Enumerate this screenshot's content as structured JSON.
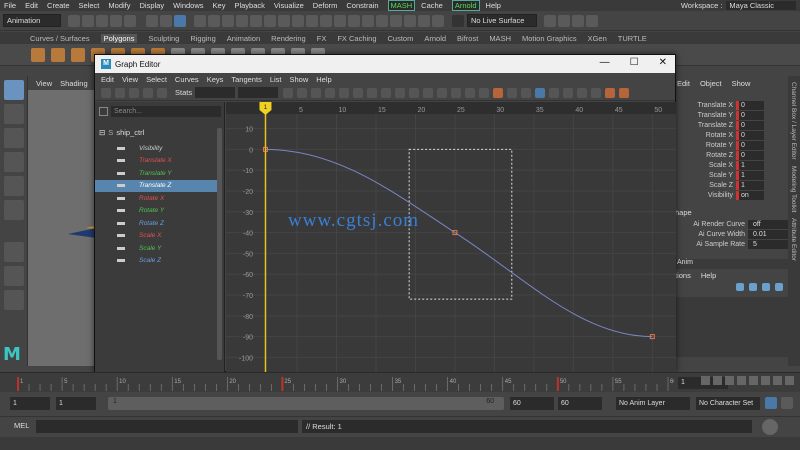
{
  "menubar": {
    "items": [
      "File",
      "Edit",
      "Create",
      "Select",
      "Modify",
      "Display",
      "Windows",
      "Key",
      "Playback",
      "Visualize",
      "Deform",
      "Constrain",
      "MASH",
      "Cache",
      "Arnold",
      "Help"
    ],
    "workspace_label": "Workspace :",
    "workspace_value": "Maya Classic"
  },
  "statusline": {
    "mode": "Animation",
    "live_surface": "No Live Surface"
  },
  "shelf": {
    "tabs": [
      "Curves / Surfaces",
      "Polygons",
      "Sculpting",
      "Rigging",
      "Animation",
      "Rendering",
      "FX",
      "FX Caching",
      "Custom",
      "Arnold",
      "Bifrost",
      "MASH",
      "Motion Graphics",
      "XGen",
      "TURTLE"
    ],
    "active_tab": "Polygons"
  },
  "viewport": {
    "menu": [
      "View",
      "Shading"
    ]
  },
  "graph_editor": {
    "title": "Graph Editor",
    "menu": [
      "Edit",
      "View",
      "Select",
      "Curves",
      "Keys",
      "Tangents",
      "List",
      "Show",
      "Help"
    ],
    "stats_label": "Stats",
    "search_placeholder": "Search...",
    "root_node": "ship_ctrl",
    "channels": [
      {
        "name": "Visibility",
        "color": "#cccccc"
      },
      {
        "name": "Translate X",
        "color": "#e05050"
      },
      {
        "name": "Translate Y",
        "color": "#50c050"
      },
      {
        "name": "Translate Z",
        "color": "#ffffff"
      },
      {
        "name": "Rotate X",
        "color": "#e05050"
      },
      {
        "name": "Rotate Y",
        "color": "#50c050"
      },
      {
        "name": "Rotate Z",
        "color": "#6a9ee0"
      },
      {
        "name": "Scale X",
        "color": "#e05050"
      },
      {
        "name": "Scale Y",
        "color": "#50c050"
      },
      {
        "name": "Scale Z",
        "color": "#6a9ee0"
      }
    ],
    "selected_channel": "Translate Z",
    "x_ticks": [
      5,
      10,
      15,
      20,
      25,
      30,
      35,
      40,
      45,
      50
    ],
    "y_ticks": [
      10,
      0,
      -10,
      -20,
      -30,
      -40,
      -50,
      -60,
      -70,
      -80,
      -90,
      -100
    ],
    "current_frame_marker": "1",
    "keys": [
      {
        "frame": 1,
        "value": 0
      },
      {
        "frame": 25,
        "value": -40
      },
      {
        "frame": 50,
        "value": -90
      }
    ],
    "x_range": [
      -4,
      53
    ],
    "y_range": [
      -107,
      17
    ],
    "curve_color": "#7a86c8",
    "key_color": "#e07a4a",
    "watermark": "www.cgtsj.com"
  },
  "channel_box": {
    "menu": [
      "Edit",
      "Object",
      "Show"
    ],
    "attributes": [
      {
        "label": "Translate X",
        "value": "0",
        "keyed": true
      },
      {
        "label": "Translate Y",
        "value": "0",
        "keyed": true
      },
      {
        "label": "Translate Z",
        "value": "0",
        "keyed": true
      },
      {
        "label": "Rotate X",
        "value": "0",
        "keyed": true
      },
      {
        "label": "Rotate Y",
        "value": "0",
        "keyed": true
      },
      {
        "label": "Rotate Z",
        "value": "0",
        "keyed": true
      },
      {
        "label": "Scale X",
        "value": "1",
        "keyed": true
      },
      {
        "label": "Scale Y",
        "value": "1",
        "keyed": true
      },
      {
        "label": "Scale Z",
        "value": "1",
        "keyed": true
      },
      {
        "label": "Visibility",
        "value": "on",
        "keyed": true
      }
    ],
    "shape_header": "hape",
    "shape_attrs": [
      {
        "label": "Ai Render Curve",
        "value": "off"
      },
      {
        "label": "Ai Curve Width",
        "value": "0.01"
      },
      {
        "label": "Ai Sample Rate",
        "value": "5"
      }
    ],
    "layer_header": "Anim",
    "layer_menu": [
      "tions",
      "Help"
    ],
    "side_tabs": [
      "Channel Box / Layer Editor",
      "Modeling Toolkit",
      "Attribute Editor"
    ]
  },
  "timeslider": {
    "ticks": [
      1,
      5,
      10,
      15,
      20,
      25,
      30,
      35,
      40,
      45,
      50,
      55,
      60
    ],
    "current_frame": "1"
  },
  "range_slider": {
    "start_outer": "1",
    "start_inner": "1",
    "bar_start": "1",
    "bar_end": "60",
    "end_inner": "60",
    "end_outer": "60",
    "anim_layer": "No Anim Layer",
    "character_set": "No Character Set"
  },
  "command_line": {
    "mode": "MEL",
    "result": "// Result: 1"
  }
}
